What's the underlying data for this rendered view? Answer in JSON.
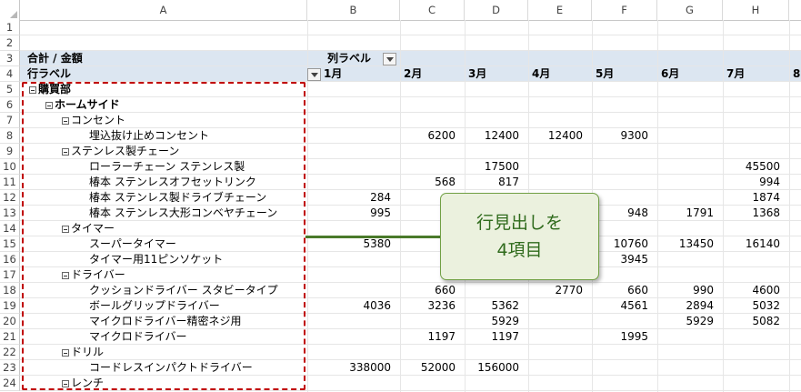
{
  "columns": [
    "A",
    "B",
    "C",
    "D",
    "E",
    "F",
    "G",
    "H"
  ],
  "rows": [
    "1",
    "2",
    "3",
    "4",
    "5",
    "6",
    "7",
    "8",
    "9",
    "10",
    "11",
    "12",
    "13",
    "14",
    "15",
    "16",
    "17",
    "18",
    "19",
    "20",
    "21",
    "22",
    "23",
    "24"
  ],
  "pivot": {
    "value_label": "合計 / 金額",
    "col_labels_title": "列ラベル",
    "row_labels_title": "行ラベル",
    "months": [
      "1月",
      "2月",
      "3月",
      "4月",
      "5月",
      "6月",
      "7月",
      "8"
    ]
  },
  "tree": [
    {
      "row": 5,
      "level": 0,
      "label": "購買部",
      "bold": true,
      "expand": true,
      "values": {}
    },
    {
      "row": 6,
      "level": 1,
      "label": "ホームサイド",
      "bold": true,
      "expand": true,
      "values": {}
    },
    {
      "row": 7,
      "level": 2,
      "label": "コンセント",
      "expand": true,
      "values": {}
    },
    {
      "row": 8,
      "level": 3,
      "label": "埋込抜け止めコンセント",
      "values": {
        "C": "6200",
        "D": "12400",
        "E": "12400",
        "F": "9300"
      }
    },
    {
      "row": 9,
      "level": 2,
      "label": "ステンレス製チェーン",
      "expand": true,
      "values": {}
    },
    {
      "row": 10,
      "level": 3,
      "label": "ローラーチェーン ステンレス製",
      "values": {
        "D": "17500",
        "H": "45500"
      }
    },
    {
      "row": 11,
      "level": 3,
      "label": "椿本 ステンレスオフセットリンク",
      "values": {
        "C": "568",
        "D": "817",
        "H": "994"
      }
    },
    {
      "row": 12,
      "level": 3,
      "label": "椿本 ステンレス製ドライブチェーン",
      "values": {
        "B": "284",
        "H": "1874"
      }
    },
    {
      "row": 13,
      "level": 3,
      "label": "椿本 ステンレス大形コンベヤチェーン",
      "values": {
        "B": "995",
        "F": "948",
        "G": "1791",
        "H": "1368"
      }
    },
    {
      "row": 14,
      "level": 2,
      "label": "タイマー",
      "expand": true,
      "values": {}
    },
    {
      "row": 15,
      "level": 3,
      "label": "スーパータイマー",
      "values": {
        "B": "5380",
        "F": "10760",
        "G": "13450",
        "H": "16140"
      }
    },
    {
      "row": 16,
      "level": 3,
      "label": "タイマー用11ピンソケット",
      "values": {
        "F": "3945"
      }
    },
    {
      "row": 17,
      "level": 2,
      "label": "ドライバー",
      "expand": true,
      "values": {}
    },
    {
      "row": 18,
      "level": 3,
      "label": "クッションドライバー スタビータイプ",
      "values": {
        "C": "660",
        "E": "2770",
        "F": "660",
        "G": "990",
        "H": "4600"
      }
    },
    {
      "row": 19,
      "level": 3,
      "label": "ボールグリップドライバー",
      "values": {
        "B": "4036",
        "C": "3236",
        "D": "5362",
        "F": "4561",
        "G": "2894",
        "H": "5032"
      }
    },
    {
      "row": 20,
      "level": 3,
      "label": "マイクロドライバー精密ネジ用",
      "values": {
        "D": "5929",
        "G": "5929",
        "H": "5082"
      }
    },
    {
      "row": 21,
      "level": 3,
      "label": "マイクロドライバー",
      "values": {
        "C": "1197",
        "D": "1197",
        "F": "1995"
      }
    },
    {
      "row": 22,
      "level": 2,
      "label": "ドリル",
      "expand": true,
      "values": {}
    },
    {
      "row": 23,
      "level": 3,
      "label": "コードレスインパクトドライバー",
      "values": {
        "B": "338000",
        "C": "52000",
        "D": "156000"
      }
    },
    {
      "row": 24,
      "level": 2,
      "label": "レンチ",
      "expand": true,
      "values": {}
    }
  ],
  "callout": {
    "line1": "行見出しを",
    "line2": "4項目"
  },
  "colors": {
    "annotation_border": "#c00000",
    "callout_fill": "#ebf1de",
    "callout_text": "#2f6b1c",
    "header_band": "#dce6f1"
  }
}
